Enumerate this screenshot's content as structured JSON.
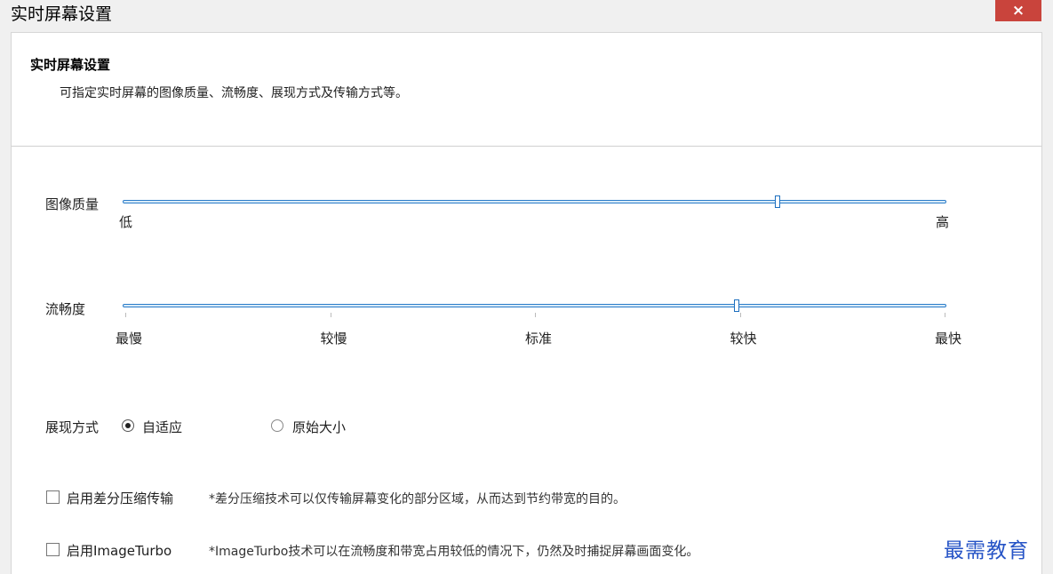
{
  "window": {
    "title": "实时屏幕设置",
    "close_label": "×"
  },
  "header": {
    "title": "实时屏幕设置",
    "description": "可指定实时屏幕的图像质量、流畅度、展现方式及传输方式等。"
  },
  "image_quality": {
    "label": "图像质量",
    "min_label": "低",
    "max_label": "高",
    "value_fraction": 0.795
  },
  "fluency": {
    "label": "流畅度",
    "ticks": [
      "最慢",
      "较慢",
      "标准",
      "较快",
      "最快"
    ],
    "value_fraction": 0.745
  },
  "display_mode": {
    "label": "展现方式",
    "options": [
      {
        "label": "自适应",
        "checked": true
      },
      {
        "label": "原始大小",
        "checked": false
      }
    ]
  },
  "options": {
    "diff_compress": {
      "label": "启用差分压缩传输",
      "note": "*差分压缩技术可以仅传输屏幕变化的部分区域，从而达到节约带宽的目的。",
      "checked": false
    },
    "image_turbo": {
      "label": "启用ImageTurbo",
      "note": "*ImageTurbo技术可以在流畅度和带宽占用较低的情况下，仍然及时捕捉屏幕画面变化。",
      "checked": false
    }
  },
  "watermark": "最需教育",
  "colors": {
    "accent": "#2b7cc9",
    "close": "#c9443c",
    "watermark": "#2553c6"
  }
}
